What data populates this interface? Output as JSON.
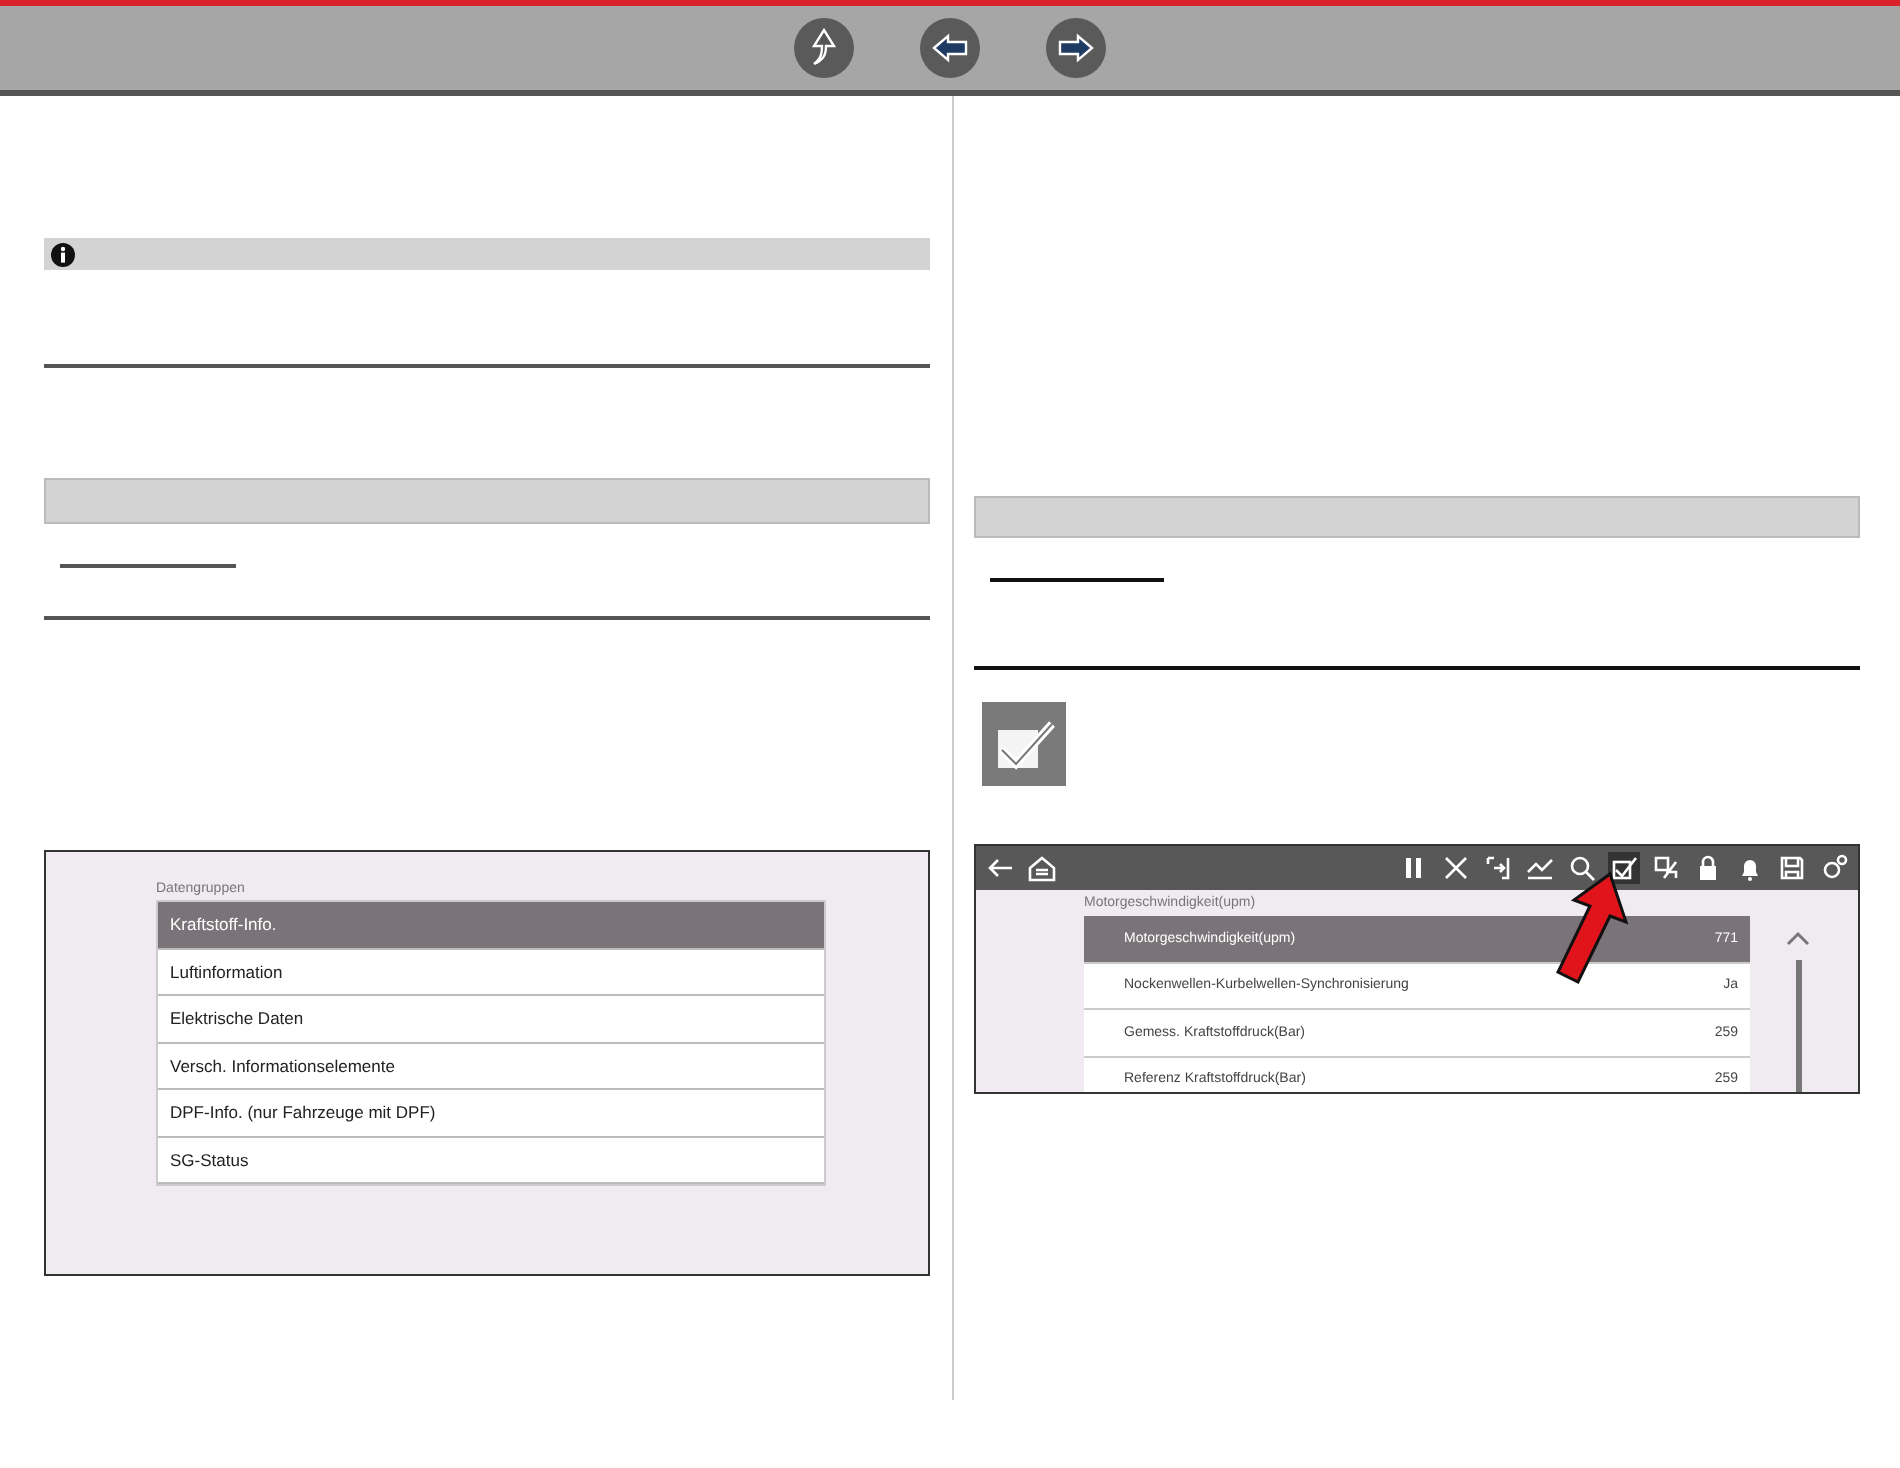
{
  "navigation": {
    "buttons": [
      {
        "kind": "up"
      },
      {
        "kind": "back"
      },
      {
        "kind": "forward"
      }
    ]
  },
  "screenshot_1": {
    "title": "Datengruppen",
    "items": [
      {
        "label": "Kraftstoff-Info.",
        "selected": true
      },
      {
        "label": "Luftinformation",
        "selected": false
      },
      {
        "label": "Elektrische Daten",
        "selected": false
      },
      {
        "label": "Versch. Informationselemente",
        "selected": false
      },
      {
        "label": "DPF-Info. (nur Fahrzeuge mit DPF)",
        "selected": false
      },
      {
        "label": "SG-Status",
        "selected": false
      }
    ]
  },
  "screenshot_2": {
    "title": "Motorgeschwindigkeit(upm)",
    "rows": [
      {
        "name": "Motorgeschwindigkeit(upm)",
        "value": "771",
        "selected": true
      },
      {
        "name": "Nockenwellen-Kurbelwellen-Synchronisierung",
        "value": "Ja",
        "selected": false
      },
      {
        "name": "Gemess. Kraftstoffdruck(Bar)",
        "value": "259",
        "selected": false
      },
      {
        "name": "Referenz Kraftstoffdruck(Bar)",
        "value": "259",
        "selected": false
      }
    ]
  }
}
